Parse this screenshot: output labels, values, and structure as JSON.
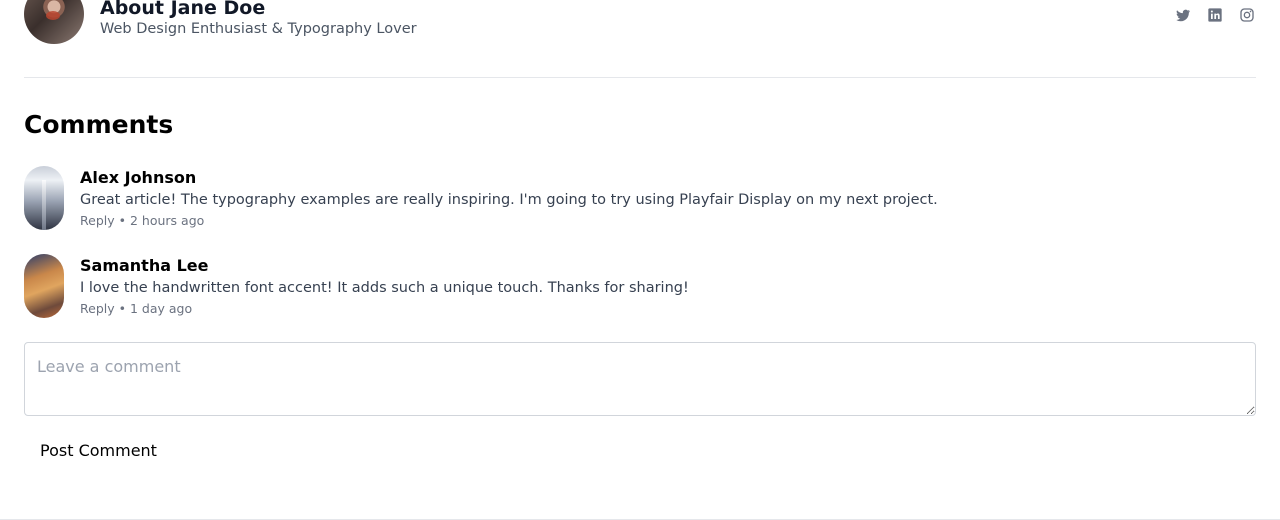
{
  "author": {
    "name": "About Jane Doe",
    "tagline": "Web Design Enthusiast & Typography Lover",
    "socials": [
      {
        "icon": "twitter-icon"
      },
      {
        "icon": "linkedin-icon"
      },
      {
        "icon": "instagram-icon"
      }
    ]
  },
  "comments_section": {
    "title": "Comments",
    "comments": [
      {
        "name": "Alex Johnson",
        "text": "Great article! The typography examples are really inspiring. I'm going to try using Playfair Display on my next project.",
        "reply_label": "Reply",
        "separator": "•",
        "time": "2 hours ago"
      },
      {
        "name": "Samantha Lee",
        "text": "I love the handwritten font accent! It adds such a unique touch. Thanks for sharing!",
        "reply_label": "Reply",
        "separator": "•",
        "time": "1 day ago"
      }
    ],
    "input_placeholder": "Leave a comment",
    "input_value": "",
    "post_button_label": "Post Comment"
  },
  "colors": {
    "icon": "#6b7280",
    "divider": "#e5e7eb",
    "meta_text": "#6b7280"
  }
}
